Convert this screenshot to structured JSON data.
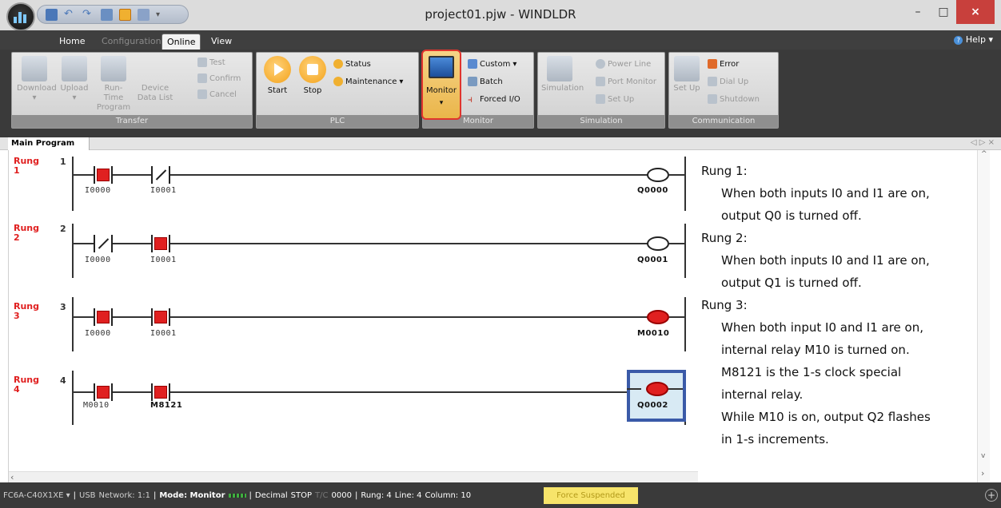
{
  "window": {
    "title": "project01.pjw - WINDLDR",
    "minimize": "–",
    "maximize": "□",
    "close": "×"
  },
  "tabs": [
    {
      "label": "Home"
    },
    {
      "label": "Configuration"
    },
    {
      "label": "Online"
    },
    {
      "label": "View"
    }
  ],
  "help_label": "Help",
  "ribbon": {
    "transfer": {
      "caption": "Transfer",
      "download": "Download",
      "upload": "Upload",
      "runtime": "Run-Time",
      "runtime2": "Program",
      "device": "Device",
      "device2": "Data List",
      "test": "Test",
      "confirm": "Confirm",
      "cancel": "Cancel"
    },
    "plc": {
      "caption": "PLC",
      "start": "Start",
      "stop": "Stop",
      "status": "Status",
      "maintenance": "Maintenance"
    },
    "monitor": {
      "caption": "Monitor",
      "monitor": "Monitor",
      "custom": "Custom",
      "batch": "Batch",
      "forced": "Forced I/O"
    },
    "simulation": {
      "caption": "Simulation",
      "simulation": "Simulation",
      "powerline": "Power Line",
      "portmon": "Port Monitor",
      "setup": "Set Up"
    },
    "communication": {
      "caption": "Communication",
      "setup": "Set Up",
      "error": "Error",
      "dialup": "Dial Up",
      "shutdown": "Shutdown"
    }
  },
  "doc_tab": "Main Program",
  "doc_controls": "◁ ▷ ×",
  "rung_word": "Rung",
  "rungs": [
    {
      "idx": "1",
      "num": "1",
      "c1": "I0000",
      "c2": "I0001",
      "coil": "Q0000"
    },
    {
      "idx": "2",
      "num": "2",
      "c1": "I0000",
      "c2": "I0001",
      "coil": "Q0001"
    },
    {
      "idx": "3",
      "num": "3",
      "c1": "I0000",
      "c2": "I0001",
      "coil": "M0010"
    },
    {
      "idx": "4",
      "num": "4",
      "c1": "M0010",
      "c2": "M8121",
      "coil": "Q0002"
    }
  ],
  "notes": {
    "r1h": "Rung 1:",
    "r1a": "When both inputs I0 and I1 are on,",
    "r1b": "output Q0 is turned off.",
    "r2h": "Rung 2:",
    "r2a": "When both inputs I0 and I1 are on,",
    "r2b": "output Q1 is turned off.",
    "r3h": "Rung 3:",
    "r3a": "When both input I0 and I1 are on,",
    "r3b": "internal relay M10 is turned on.",
    "r3c": "M8121 is the 1-s clock special",
    "r3d": "internal relay.",
    "r3e": "While M10 is on, output Q2 flashes",
    "r3f": "in 1-s increments."
  },
  "status": {
    "plc": "FC6A-C40X1XE ▾",
    "usb": "USB",
    "network": "Network: 1:1",
    "mode": "Mode: Monitor",
    "decimal": "Decimal",
    "stop": "STOP",
    "tc": "T/C",
    "count": "0000",
    "rung": "Rung: 4",
    "line": "Line: 4",
    "column": "Column: 10",
    "force": "Force Suspended"
  }
}
